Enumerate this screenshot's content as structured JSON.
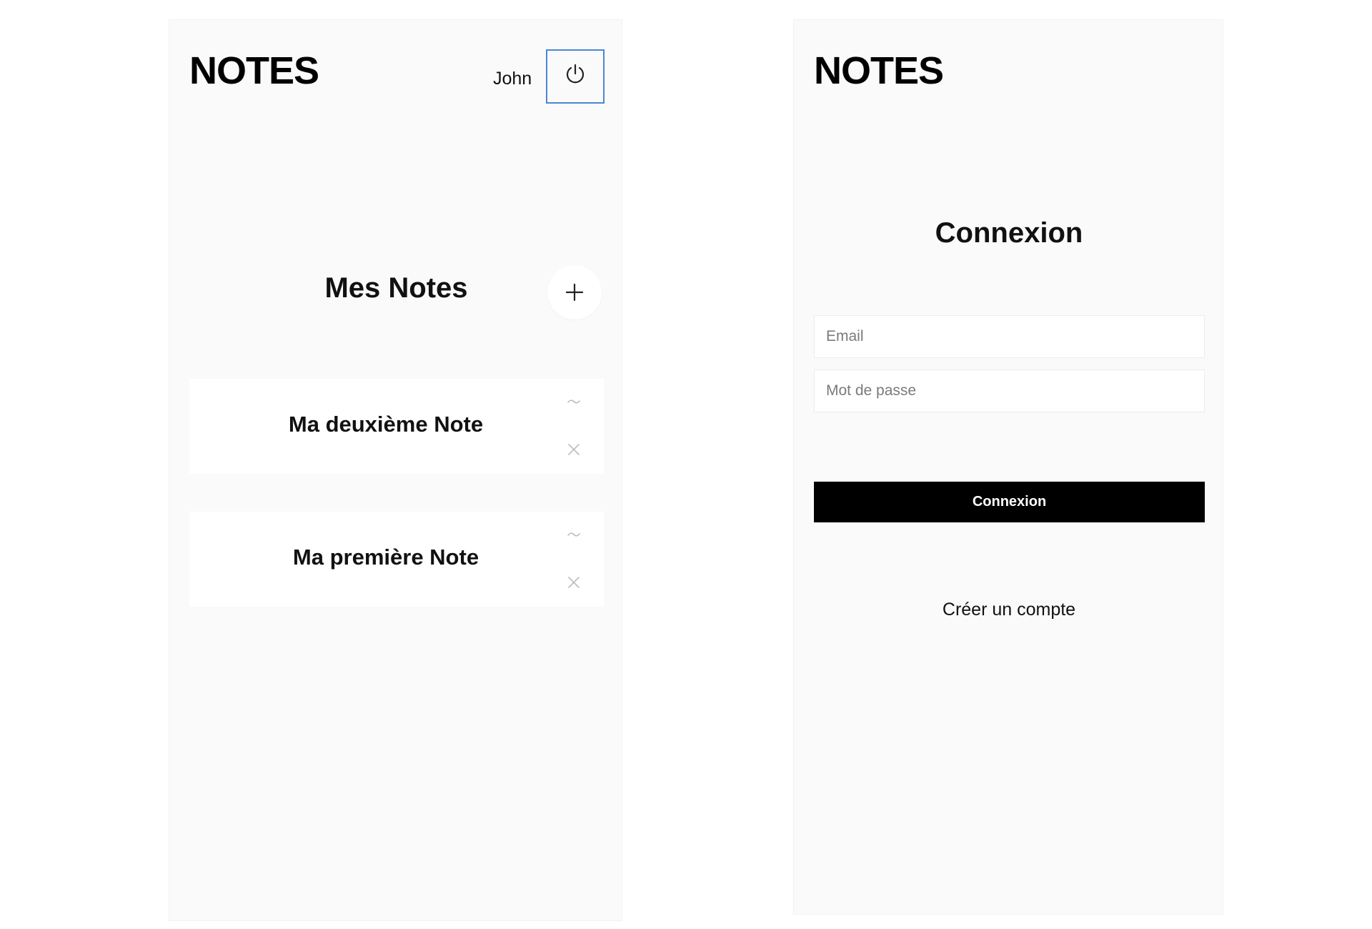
{
  "colors": {
    "screen_background": "#fafafa",
    "card_background": "#ffffff",
    "focus_border": "#4a86d8",
    "primary_button": "#000000",
    "primary_button_text": "#ffffff",
    "muted_icon": "#bdbdbd"
  },
  "notes_screen": {
    "app_title": "NOTES",
    "user_name": "John",
    "logout_icon": "power-icon",
    "section_title": "Mes Notes",
    "add_icon": "plus-icon",
    "notes": [
      {
        "title": "Ma deuxième Note",
        "edit_icon": "tilde-icon",
        "delete_icon": "close-icon"
      },
      {
        "title": "Ma première Note",
        "edit_icon": "tilde-icon",
        "delete_icon": "close-icon"
      }
    ]
  },
  "login_screen": {
    "app_title": "NOTES",
    "title": "Connexion",
    "email_placeholder": "Email",
    "email_value": "",
    "password_placeholder": "Mot de passe",
    "password_value": "",
    "submit_label": "Connexion",
    "create_account_label": "Créer un compte"
  }
}
